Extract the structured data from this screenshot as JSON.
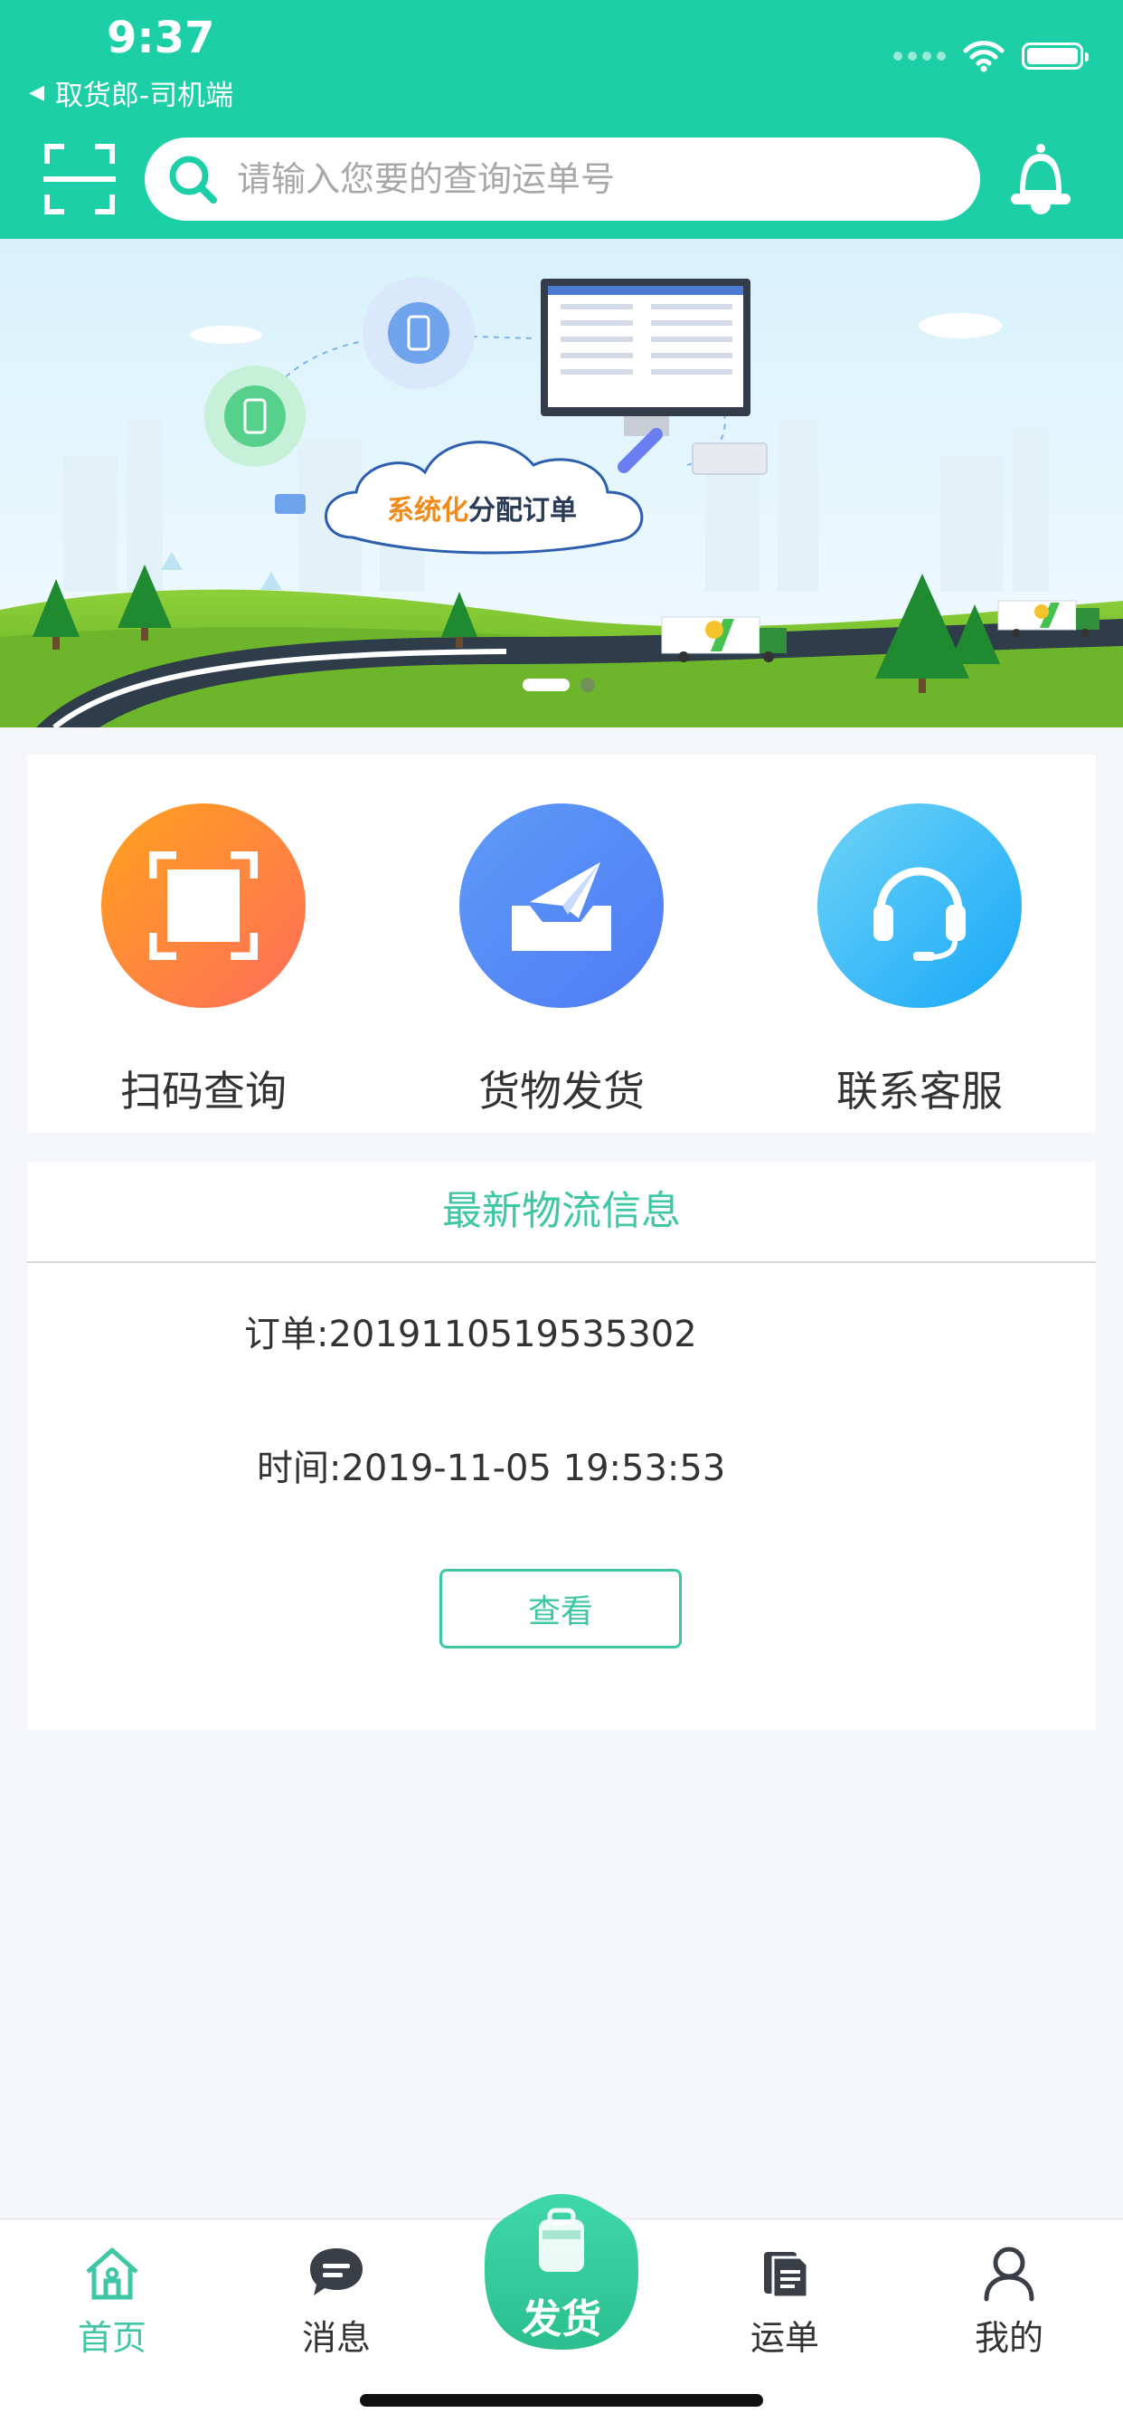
{
  "status_bar": {
    "time": "9:37",
    "back_app": "取货郎-司机端"
  },
  "header": {
    "search_placeholder": "请输入您要的查询运单号"
  },
  "banner": {
    "cloud_text_orange": "系统化",
    "cloud_text_dark": "分配订单"
  },
  "quick_actions": [
    {
      "label": "扫码查询",
      "icon": "scan-icon"
    },
    {
      "label": "货物发货",
      "icon": "paper-plane-inbox-icon"
    },
    {
      "label": "联系客服",
      "icon": "headset-icon"
    }
  ],
  "logistics": {
    "title": "最新物流信息",
    "order": "订单:2019110519535302",
    "time": "时间:2019-11-05 19:53:53",
    "view_button": "查看"
  },
  "tabbar": {
    "items": [
      {
        "label": "首页",
        "icon": "home-icon",
        "active": true
      },
      {
        "label": "消息",
        "icon": "message-icon",
        "active": false
      },
      {
        "label": "发货",
        "icon": "ship-bag-icon",
        "active": false
      },
      {
        "label": "运单",
        "icon": "waybill-icon",
        "active": false
      },
      {
        "label": "我的",
        "icon": "user-icon",
        "active": false
      }
    ]
  },
  "colors": {
    "primary": "#1dcfa7",
    "accent_text": "#3fc6a4",
    "background": "#f5f6f9"
  }
}
